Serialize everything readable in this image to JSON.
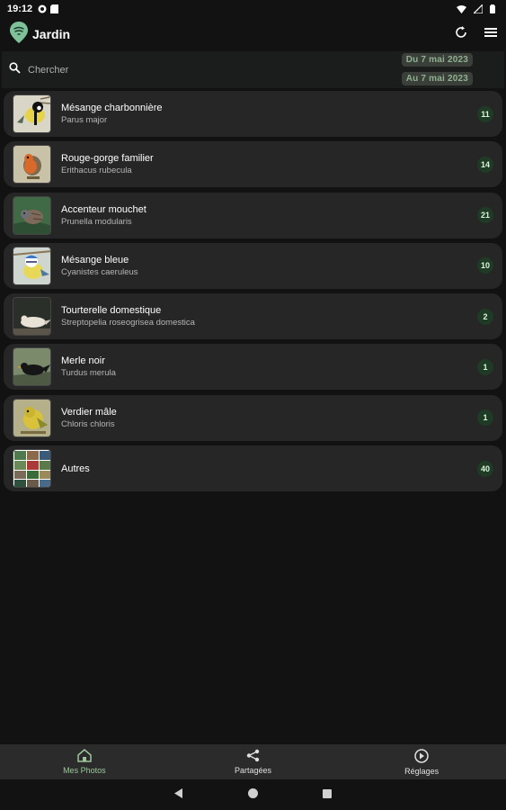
{
  "status_bar": {
    "time": "19:12"
  },
  "app_bar": {
    "title": "Jardin"
  },
  "search": {
    "placeholder": "Chercher",
    "date_from": "Du 7 mai 2023",
    "date_to": "Au 7 mai 2023"
  },
  "species": [
    {
      "name": "Mésange charbonnière",
      "latin": "Parus major",
      "count": "11"
    },
    {
      "name": "Rouge-gorge familier",
      "latin": "Erithacus rubecula",
      "count": "14"
    },
    {
      "name": "Accenteur mouchet",
      "latin": "Prunella modularis",
      "count": "21"
    },
    {
      "name": "Mésange bleue",
      "latin": "Cyanistes caeruleus",
      "count": "10"
    },
    {
      "name": "Tourterelle domestique",
      "latin": "Streptopelia roseogrisea domestica",
      "count": "2"
    },
    {
      "name": "Merle noir",
      "latin": "Turdus merula",
      "count": "1"
    },
    {
      "name": "Verdier mâle",
      "latin": "Chloris chloris",
      "count": "1"
    },
    {
      "name": "Autres",
      "latin": "",
      "count": "40"
    }
  ],
  "bottom_nav": {
    "photos": "Mes Photos",
    "shared": "Partagées",
    "settings": "Réglages",
    "active": "photos"
  },
  "colors": {
    "accent": "#9cc59c",
    "badge": "#1f3a25",
    "card": "#262626",
    "background": "#121212"
  },
  "icons": [
    "refresh-icon",
    "menu-icon",
    "search-icon",
    "home-icon",
    "share-icon",
    "settings-icon",
    "back-icon",
    "home-circle-icon",
    "recents-icon"
  ]
}
